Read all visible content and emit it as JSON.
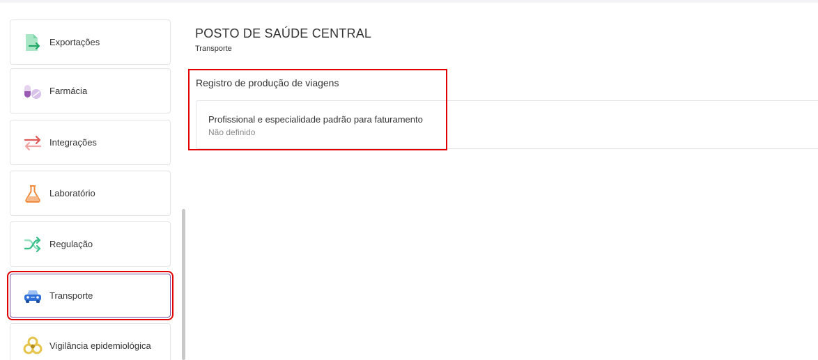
{
  "sidebar": {
    "items": [
      {
        "label": "Exportações",
        "icon": "export-icon"
      },
      {
        "label": "Farmácia",
        "icon": "pills-icon"
      },
      {
        "label": "Integrações",
        "icon": "arrows-exchange-icon"
      },
      {
        "label": "Laboratório",
        "icon": "flask-icon"
      },
      {
        "label": "Regulação",
        "icon": "shuffle-icon"
      },
      {
        "label": "Transporte",
        "icon": "car-icon",
        "active": true
      },
      {
        "label": "Vigilância epidemiológica",
        "icon": "biohazard-icon"
      }
    ]
  },
  "header": {
    "title": "POSTO DE SAÚDE CENTRAL",
    "subtitle": "Transporte"
  },
  "section": {
    "title": "Registro de produção de viagens",
    "setting": {
      "label": "Profissional e especialidade padrão para faturamento",
      "value": "Não definido"
    }
  },
  "colors": {
    "highlight": "#e00000",
    "active_border": "#7a4fa0",
    "export_green": "#4cc38a",
    "pharmacy_purple": "#9b59b6",
    "integration_red": "#e05a5a",
    "lab_orange": "#f08a3c",
    "regulation_green": "#3bbf8a",
    "transport_blue": "#2f6fd6",
    "vigilance_yellow": "#e6c34a"
  }
}
